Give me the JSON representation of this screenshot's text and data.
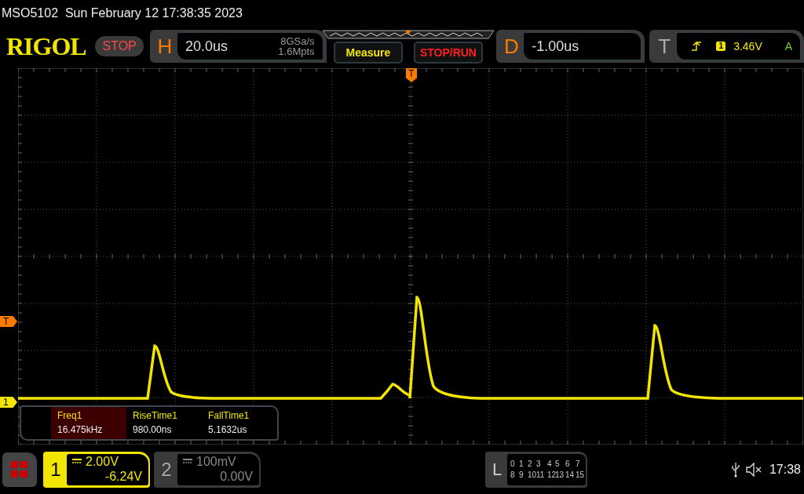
{
  "status_line": "MSO5102  Sun February 12 17:38:35 2023",
  "logo": "RIGOL",
  "run_state": {
    "label": "STOP",
    "running": false
  },
  "horizontal": {
    "label": "H",
    "timebase": "20.0us",
    "sample_rate": "8GSa/s",
    "memory_depth": "1.6Mpts"
  },
  "buttons": [
    {
      "label": "Measure",
      "kind": "measure"
    },
    {
      "label": "STOP/RUN",
      "kind": "stoprun"
    }
  ],
  "delay": {
    "label": "D",
    "value": "-1.00us"
  },
  "trigger": {
    "label": "T",
    "source": "1",
    "level": "3.46V",
    "mode": "A"
  },
  "top_marker": "T",
  "markers": [
    {
      "label": "T",
      "kind": "trigger"
    },
    {
      "label": "1",
      "kind": "channel"
    }
  ],
  "measurements": [
    {
      "name": "Freq1",
      "value": "16.475kHz",
      "selected": true
    },
    {
      "name": "RiseTime1",
      "value": "980.00ns",
      "selected": false
    },
    {
      "name": "FallTime1",
      "value": "5.1632us",
      "selected": false
    }
  ],
  "channels": [
    {
      "label": "1",
      "scale": "2.00V",
      "offset": "-6.24V",
      "selected": true
    },
    {
      "label": "2",
      "scale": "100mV",
      "offset": "0.00V",
      "selected": false
    }
  ],
  "logic": {
    "label": "L",
    "rows": [
      [
        "0",
        "1",
        "2",
        "3",
        "4",
        "5",
        "6",
        "7"
      ],
      [
        "8",
        "9",
        "10",
        "11",
        "12",
        "13",
        "14",
        "15"
      ]
    ]
  },
  "clock": "17:38"
}
